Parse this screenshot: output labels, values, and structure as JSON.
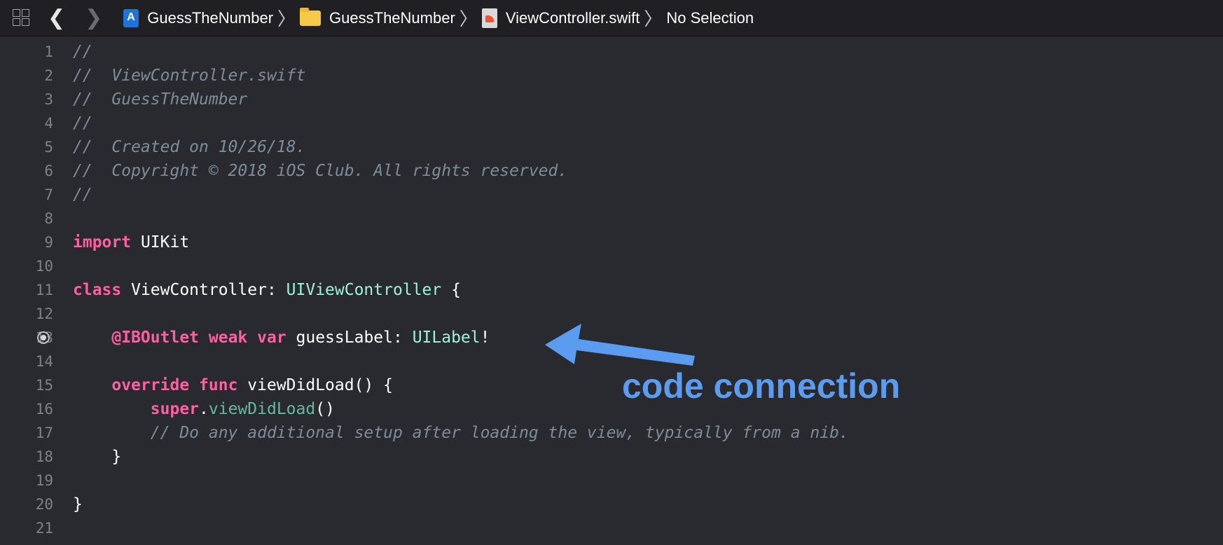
{
  "jumpbar": {
    "project": "GuessTheNumber",
    "group": "GuessTheNumber",
    "file": "ViewController.swift",
    "selection": "No Selection"
  },
  "code_lines": [
    {
      "n": "1",
      "tokens": [
        {
          "t": "//",
          "c": "comment"
        }
      ]
    },
    {
      "n": "2",
      "tokens": [
        {
          "t": "//  ViewController.swift",
          "c": "comment"
        }
      ]
    },
    {
      "n": "3",
      "tokens": [
        {
          "t": "//  GuessTheNumber",
          "c": "comment"
        }
      ]
    },
    {
      "n": "4",
      "tokens": [
        {
          "t": "//",
          "c": "comment"
        }
      ]
    },
    {
      "n": "5",
      "tokens": [
        {
          "t": "//  Created on 10/26/18.",
          "c": "comment"
        }
      ]
    },
    {
      "n": "6",
      "tokens": [
        {
          "t": "//  Copyright © 2018 iOS Club. All rights reserved.",
          "c": "comment"
        }
      ]
    },
    {
      "n": "7",
      "tokens": [
        {
          "t": "//",
          "c": "comment"
        }
      ]
    },
    {
      "n": "8",
      "tokens": []
    },
    {
      "n": "9",
      "tokens": [
        {
          "t": "import",
          "c": "kw"
        },
        {
          "t": " UIKit",
          "c": "plain"
        }
      ]
    },
    {
      "n": "10",
      "tokens": []
    },
    {
      "n": "11",
      "tokens": [
        {
          "t": "class",
          "c": "kw"
        },
        {
          "t": " ViewController: ",
          "c": "plain"
        },
        {
          "t": "UIViewController",
          "c": "type"
        },
        {
          "t": " {",
          "c": "plain"
        }
      ]
    },
    {
      "n": "12",
      "tokens": []
    },
    {
      "n": "13",
      "outlet": true,
      "tokens": [
        {
          "t": "    ",
          "c": "plain"
        },
        {
          "t": "@IBOutlet",
          "c": "kw"
        },
        {
          "t": " ",
          "c": "plain"
        },
        {
          "t": "weak",
          "c": "kw"
        },
        {
          "t": " ",
          "c": "plain"
        },
        {
          "t": "var",
          "c": "kw"
        },
        {
          "t": " guessLabel: ",
          "c": "plain"
        },
        {
          "t": "UILabel",
          "c": "type"
        },
        {
          "t": "!",
          "c": "plain"
        }
      ]
    },
    {
      "n": "14",
      "tokens": []
    },
    {
      "n": "15",
      "tokens": [
        {
          "t": "    ",
          "c": "plain"
        },
        {
          "t": "override",
          "c": "kw"
        },
        {
          "t": " ",
          "c": "plain"
        },
        {
          "t": "func",
          "c": "kw"
        },
        {
          "t": " viewDidLoad() {",
          "c": "plain"
        }
      ]
    },
    {
      "n": "16",
      "tokens": [
        {
          "t": "        ",
          "c": "plain"
        },
        {
          "t": "super",
          "c": "kw"
        },
        {
          "t": ".",
          "c": "plain"
        },
        {
          "t": "viewDidLoad",
          "c": "fn"
        },
        {
          "t": "()",
          "c": "plain"
        }
      ]
    },
    {
      "n": "17",
      "tokens": [
        {
          "t": "        // Do any additional setup after loading the view, typically from a nib.",
          "c": "comment"
        }
      ]
    },
    {
      "n": "18",
      "tokens": [
        {
          "t": "    }",
          "c": "plain"
        }
      ]
    },
    {
      "n": "19",
      "tokens": []
    },
    {
      "n": "20",
      "tokens": [
        {
          "t": "}",
          "c": "plain"
        }
      ]
    },
    {
      "n": "21",
      "tokens": []
    }
  ],
  "annotation": {
    "label": "code connection",
    "color": "#5b9cf0"
  }
}
